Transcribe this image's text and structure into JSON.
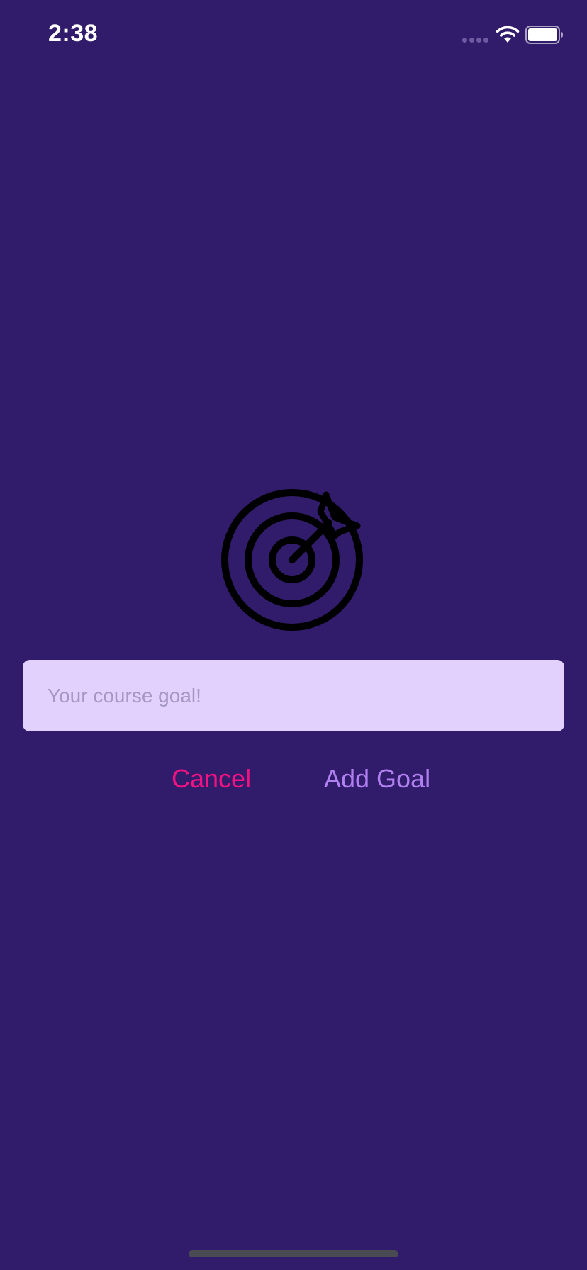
{
  "status_bar": {
    "time": "2:38",
    "icons": [
      "signal-dots-icon",
      "wifi-icon",
      "battery-icon"
    ]
  },
  "main": {
    "image_icon": "target-icon",
    "goal_input": {
      "value": "",
      "placeholder": "Your course goal!"
    },
    "buttons": {
      "cancel_label": "Cancel",
      "add_label": "Add Goal"
    }
  },
  "colors": {
    "background": "#311b6b",
    "input_background": "#e2d1fd",
    "cancel": "#f31282",
    "add_goal": "#b180f0",
    "placeholder": "#a598c0"
  }
}
